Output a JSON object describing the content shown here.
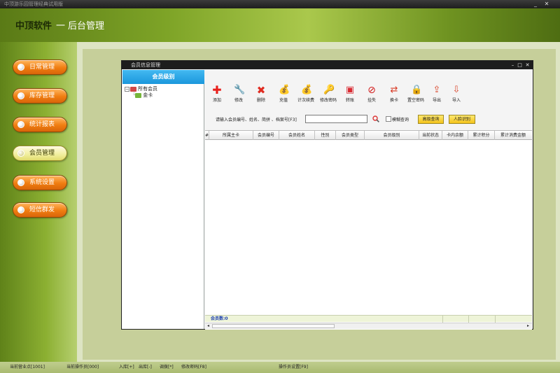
{
  "app": {
    "window_title": "中顶游乐园管理经典试用版",
    "brand": "中顶软件",
    "separator": "一",
    "subtitle": "后台管理"
  },
  "sidebar": {
    "items": [
      {
        "label": "日常管理",
        "active": false
      },
      {
        "label": "库存管理",
        "active": false
      },
      {
        "label": "统计报表",
        "active": false
      },
      {
        "label": "会员管理",
        "active": true
      },
      {
        "label": "系统设置",
        "active": false
      },
      {
        "label": "短信群发",
        "active": false
      }
    ]
  },
  "member_window": {
    "title": "会员信息管理",
    "tree": {
      "header": "会员级别",
      "root": "所有会员",
      "child": "金卡"
    },
    "toolbar": [
      {
        "label": "添加",
        "icon": "plus-icon",
        "color": "#e8201c"
      },
      {
        "label": "修改",
        "icon": "wrench-icon",
        "color": "#c43a2a"
      },
      {
        "label": "删除",
        "icon": "delete-x-icon",
        "color": "#e02b20"
      },
      {
        "label": "充值",
        "icon": "money-bag-icon",
        "color": "#c79b1e"
      },
      {
        "label": "计次续费",
        "icon": "money-bag-icon",
        "color": "#c79b1e"
      },
      {
        "label": "修改密码",
        "icon": "key-icon",
        "color": "#d2541f"
      },
      {
        "label": "转账",
        "icon": "card-icon",
        "color": "#d92a32"
      },
      {
        "label": "挂失",
        "icon": "forbidden-icon",
        "color": "#d21a1a"
      },
      {
        "label": "换卡",
        "icon": "card-swap-icon",
        "color": "#d93a24"
      },
      {
        "label": "置空密码",
        "icon": "lock-reset-icon",
        "color": "#d92a32"
      },
      {
        "label": "导出",
        "icon": "export-icon",
        "color": "#d9452a"
      },
      {
        "label": "导入",
        "icon": "import-icon",
        "color": "#d9452a"
      }
    ],
    "search": {
      "label": "请输入会员编号、姓名、简拼 、档案号[F3]",
      "value": "",
      "fuzzy_label": "模糊查询",
      "advanced_label": "高级查询",
      "face_label": "人脸识别"
    },
    "grid": {
      "columns": [
        "#",
        "所属主卡",
        "会员编号",
        "会员姓名",
        "性别",
        "会员类型",
        "会员级别",
        "当前状态",
        "卡内余额",
        "累计积分",
        "累计消费金额"
      ],
      "rows": [],
      "footer_count": "会员数:0"
    }
  },
  "status_bar": {
    "store": "当前营业点[1001]",
    "operator": "当前操作员[000]",
    "stock_in": "入库[+]",
    "stock_out": "出库[-]",
    "transfer": "调拨[*]",
    "change_pwd": "修改密码[F8]",
    "operator_settings": "操作员设置[F9]"
  },
  "colors": {
    "tree_header": "#1b97dc",
    "nav_button": "#f07d10",
    "nav_button_active": "#f2f0a2",
    "title_bar": "#1d1d1d"
  }
}
